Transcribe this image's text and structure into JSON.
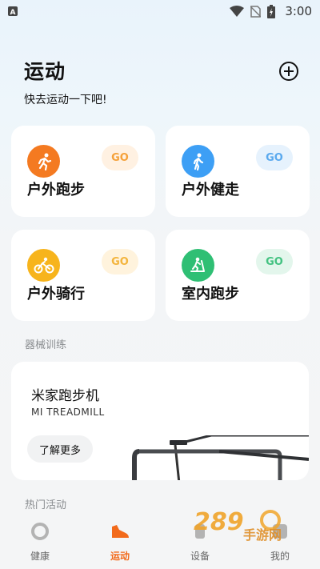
{
  "status_bar": {
    "time": "3:00",
    "icons": [
      "notification-a-icon",
      "wifi-icon",
      "no-sim-icon",
      "battery-charging-icon"
    ]
  },
  "header": {
    "title": "运动",
    "subtitle": "快去运动一下吧!",
    "add_icon": "plus-circle-icon"
  },
  "sports": [
    {
      "label": "户外跑步",
      "go": "GO",
      "icon": "running-icon",
      "color": "#f47a21",
      "pill_bg": "#fff1e2",
      "pill_fg": "#f5a13a"
    },
    {
      "label": "户外健走",
      "go": "GO",
      "icon": "walking-icon",
      "color": "#3d9ff5",
      "pill_bg": "#e6f2fd",
      "pill_fg": "#5aa9ee"
    },
    {
      "label": "户外骑行",
      "go": "GO",
      "icon": "cycling-icon",
      "color": "#f7b41c",
      "pill_bg": "#fff3dd",
      "pill_fg": "#f3b43c"
    },
    {
      "label": "室内跑步",
      "go": "GO",
      "icon": "treadmill-icon",
      "color": "#2fbf74",
      "pill_bg": "#e3f6ec",
      "pill_fg": "#43c281"
    }
  ],
  "equipment_section": {
    "label": "器械训练",
    "card": {
      "title": "米家跑步机",
      "subtitle": "MI TREADMILL",
      "button": "了解更多"
    }
  },
  "hot_section": {
    "label": "热门活动"
  },
  "tabs": [
    {
      "label": "健康",
      "icon": "health-ring-icon",
      "active": false
    },
    {
      "label": "运动",
      "icon": "shoe-icon",
      "active": true
    },
    {
      "label": "设备",
      "icon": "device-icon",
      "active": false
    },
    {
      "label": "我的",
      "icon": "profile-icon",
      "active": false
    }
  ],
  "watermark": {
    "text": "289 手游网",
    "color": "#f0a42a"
  }
}
